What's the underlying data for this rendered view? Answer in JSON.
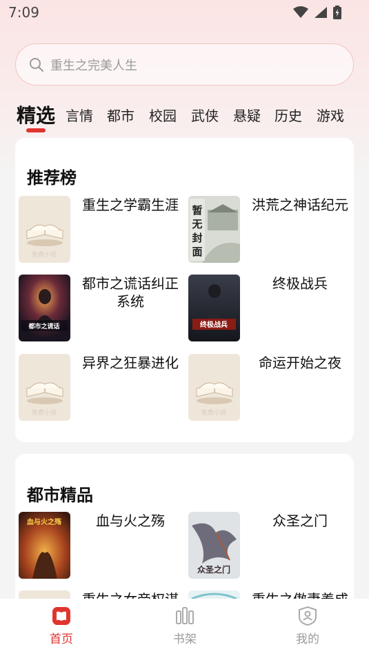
{
  "status": {
    "time": "7:09"
  },
  "search": {
    "placeholder": "重生之完美人生"
  },
  "tabs": [
    "精选",
    "言情",
    "都市",
    "校园",
    "武侠",
    "悬疑",
    "历史",
    "游戏"
  ],
  "sections": [
    {
      "title": "推荐榜",
      "books": [
        {
          "title": "重生之学霸生涯",
          "cover": "default-cover"
        },
        {
          "title": "洪荒之神话纪元",
          "cover": "no-cover",
          "cover_text": "暂无封面"
        },
        {
          "title": "都市之谎话纠正系统",
          "cover": "dark-hero-cover",
          "cover_text": "都市之谎话纠正系统"
        },
        {
          "title": "终极战兵",
          "cover": "dark-soldier-cover",
          "cover_text": "终极战兵"
        },
        {
          "title": "异界之狂暴进化",
          "cover": "default-cover"
        },
        {
          "title": "命运开始之夜",
          "cover": "default-cover"
        }
      ]
    },
    {
      "title": "都市精品",
      "books": [
        {
          "title": "血与火之殇",
          "cover": "fire-cover",
          "cover_text": "血与火之殇"
        },
        {
          "title": "众圣之门",
          "cover": "dragon-cover",
          "cover_text": "众圣之门"
        },
        {
          "title": "重生之女帝权谋",
          "cover": "default-cover"
        },
        {
          "title": "重生之傲妻养成",
          "cover": "default-cover"
        }
      ]
    }
  ],
  "default_cover_watermark": "免费小说",
  "nav": [
    {
      "label": "首页",
      "icon": "home-book-icon",
      "active": true
    },
    {
      "label": "书架",
      "icon": "bookshelf-icon",
      "active": false
    },
    {
      "label": "我的",
      "icon": "profile-shield-icon",
      "active": false
    }
  ],
  "colors": {
    "accent": "#e0342f",
    "background": "#f4f4f4",
    "card": "#ffffff"
  }
}
